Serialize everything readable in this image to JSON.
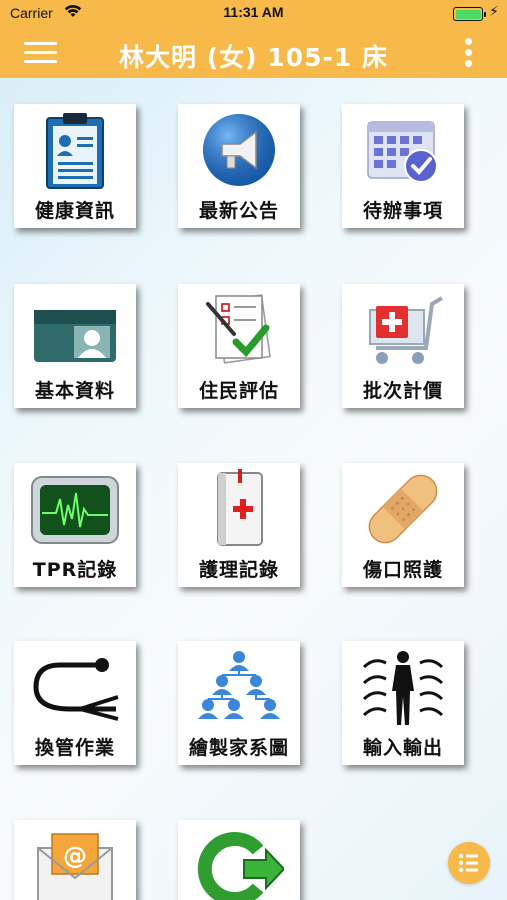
{
  "status_bar": {
    "carrier": "Carrier",
    "time": "11:31 AM"
  },
  "header": {
    "title": "林大明 (女) 105-1 床",
    "menu_icon": "hamburger-icon",
    "more_icon": "more-vertical-icon"
  },
  "theme": {
    "header_color": "#f6b94a",
    "fab_color": "#f6b94a"
  },
  "menu_tiles": [
    {
      "label": "健康資訊",
      "icon": "clipboard-id-icon"
    },
    {
      "label": "最新公告",
      "icon": "megaphone-icon"
    },
    {
      "label": "待辦事項",
      "icon": "calendar-check-icon"
    },
    {
      "label": "基本資料",
      "icon": "id-card-icon"
    },
    {
      "label": "住民評估",
      "icon": "checklist-pen-icon"
    },
    {
      "label": "批次計價",
      "icon": "shopping-cart-icon"
    },
    {
      "label": "TPR記錄",
      "icon": "vital-monitor-icon"
    },
    {
      "label": "護理記錄",
      "icon": "medical-book-icon"
    },
    {
      "label": "傷口照護",
      "icon": "bandage-icon"
    },
    {
      "label": "換管作業",
      "icon": "catheter-tube-icon"
    },
    {
      "label": "繪製家系圖",
      "icon": "family-tree-icon"
    },
    {
      "label": "輸入輸出",
      "icon": "body-flow-icon"
    },
    {
      "label": "",
      "icon": "email-icon"
    },
    {
      "label": "",
      "icon": "logout-arrow-icon"
    }
  ],
  "fab": {
    "icon": "list-icon"
  }
}
